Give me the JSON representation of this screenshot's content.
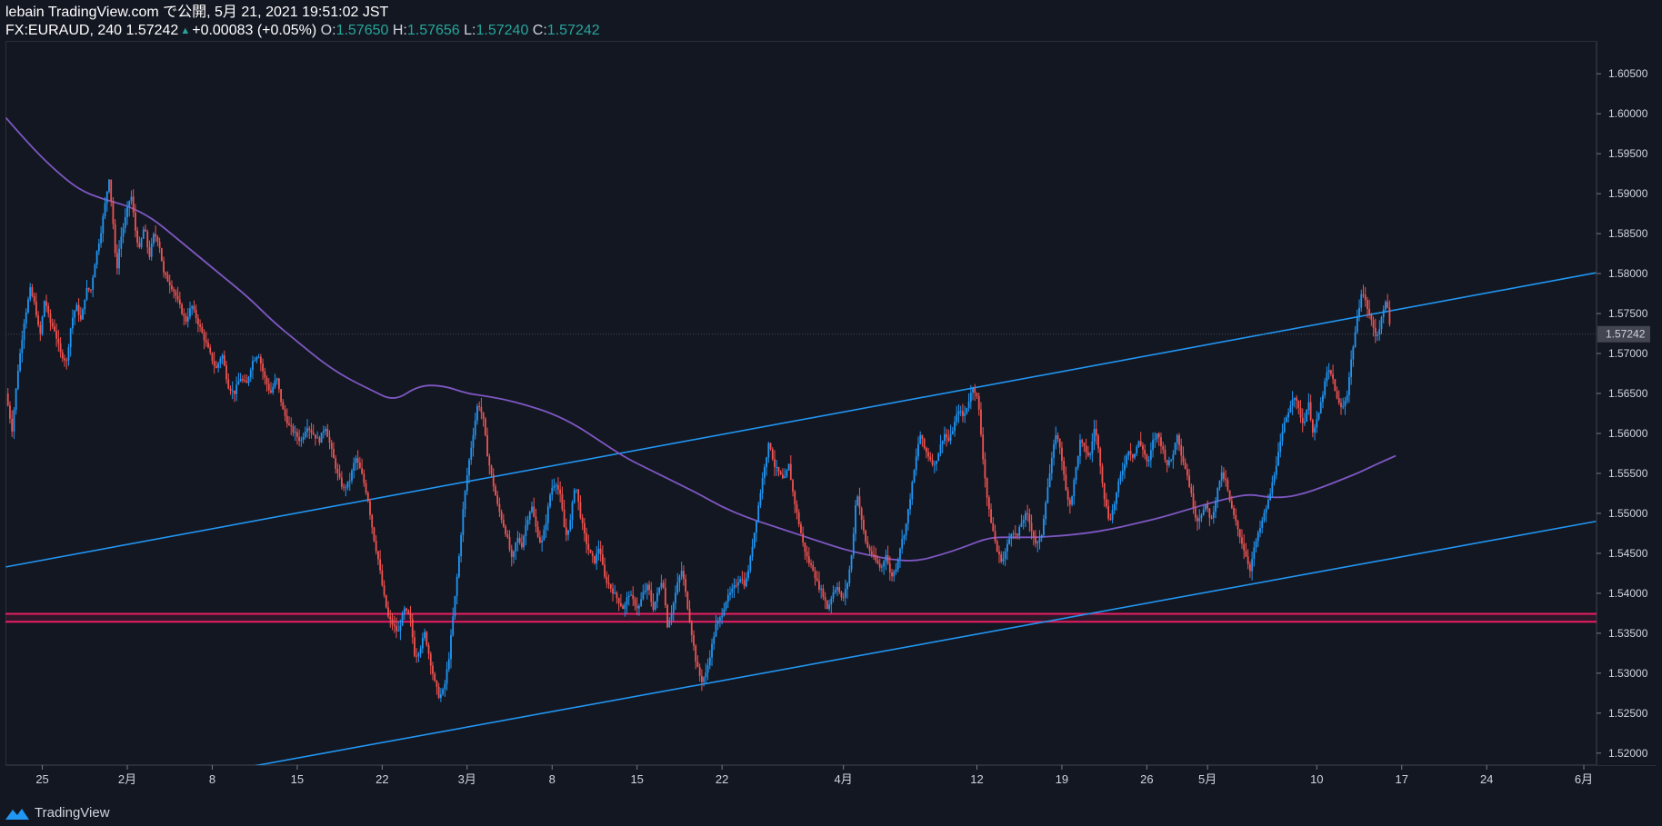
{
  "header": {
    "publish_line": "lebain TradingView.com で公開, 5月 21, 2021 19:51:02 JST",
    "symbol": "FX:EURAUD, 240 1.57242",
    "change": "+0.00083 (+0.05%)",
    "o_label": "O:",
    "o_value": "1.57650",
    "h_label": "H:",
    "h_value": "1.57656",
    "l_label": "L:",
    "l_value": "1.57240",
    "c_label": "C:",
    "c_value": "1.57242"
  },
  "footer": {
    "brand": "TradingView"
  },
  "colors": {
    "background": "#131722",
    "up_candle": "#2196f3",
    "down_candle": "#ef5350",
    "trendline": "#2196f3",
    "moving_average": "#7e57c2",
    "support_zone": "#e91e63",
    "last_price_badge": "#434651",
    "change_green": "#26a69a"
  },
  "chart_data": {
    "type": "line",
    "symbol": "FX:EURAUD",
    "timeframe": "240",
    "x_ticks": [
      {
        "label": "25",
        "day": -7
      },
      {
        "label": "2月",
        "day": 0
      },
      {
        "label": "8",
        "day": 7
      },
      {
        "label": "15",
        "day": 14
      },
      {
        "label": "22",
        "day": 21
      },
      {
        "label": "3月",
        "day": 28
      },
      {
        "label": "8",
        "day": 35
      },
      {
        "label": "15",
        "day": 42
      },
      {
        "label": "22",
        "day": 49
      },
      {
        "label": "4月",
        "day": 59
      },
      {
        "label": "12",
        "day": 70
      },
      {
        "label": "19",
        "day": 77
      },
      {
        "label": "26",
        "day": 84
      },
      {
        "label": "5月",
        "day": 89
      },
      {
        "label": "10",
        "day": 98
      },
      {
        "label": "17",
        "day": 105
      },
      {
        "label": "24",
        "day": 112
      },
      {
        "label": "6月",
        "day": 120
      }
    ],
    "y_ticks": [
      "1.60500",
      "1.60000",
      "1.59500",
      "1.59000",
      "1.58500",
      "1.58000",
      "1.57500",
      "1.57000",
      "1.56500",
      "1.56000",
      "1.55500",
      "1.55000",
      "1.54500",
      "1.54000",
      "1.53500",
      "1.53000",
      "1.52500",
      "1.52000"
    ],
    "y_range": [
      1.5185,
      1.609
    ],
    "last_price": "1.57242",
    "price_path": [
      [
        -10,
        1.565
      ],
      [
        -9.5,
        1.5605
      ],
      [
        -9,
        1.568
      ],
      [
        -8.5,
        1.574
      ],
      [
        -8,
        1.578
      ],
      [
        -7.6,
        1.576
      ],
      [
        -7.2,
        1.572
      ],
      [
        -6.8,
        1.577
      ],
      [
        -6.4,
        1.574
      ],
      [
        -6,
        1.573
      ],
      [
        -5.5,
        1.57
      ],
      [
        -5,
        1.569
      ],
      [
        -4.6,
        1.574
      ],
      [
        -4.2,
        1.576
      ],
      [
        -3.8,
        1.574
      ],
      [
        -3.4,
        1.578
      ],
      [
        -3,
        1.578
      ],
      [
        -2.6,
        1.582
      ],
      [
        -2.2,
        1.585
      ],
      [
        -1.8,
        1.589
      ],
      [
        -1.5,
        1.592
      ],
      [
        -1.2,
        1.587
      ],
      [
        -0.9,
        1.58
      ],
      [
        -0.6,
        1.584
      ],
      [
        -0.3,
        1.586
      ],
      [
        0,
        1.588
      ],
      [
        0.3,
        1.59
      ],
      [
        0.7,
        1.585
      ],
      [
        1,
        1.583
      ],
      [
        1.4,
        1.586
      ],
      [
        1.8,
        1.582
      ],
      [
        2.2,
        1.585
      ],
      [
        2.6,
        1.584
      ],
      [
        3,
        1.58
      ],
      [
        3.4,
        1.579
      ],
      [
        3.8,
        1.578
      ],
      [
        4.3,
        1.576
      ],
      [
        4.8,
        1.574
      ],
      [
        5.3,
        1.576
      ],
      [
        5.8,
        1.574
      ],
      [
        6.3,
        1.572
      ],
      [
        6.8,
        1.57
      ],
      [
        7.3,
        1.568
      ],
      [
        7.8,
        1.57
      ],
      [
        8.3,
        1.566
      ],
      [
        8.8,
        1.565
      ],
      [
        9.3,
        1.567
      ],
      [
        9.8,
        1.566
      ],
      [
        10.3,
        1.569
      ],
      [
        10.8,
        1.57
      ],
      [
        11.3,
        1.567
      ],
      [
        11.8,
        1.565
      ],
      [
        12.3,
        1.567
      ],
      [
        12.8,
        1.563
      ],
      [
        13.3,
        1.561
      ],
      [
        13.8,
        1.56
      ],
      [
        14.3,
        1.559
      ],
      [
        14.8,
        1.561
      ],
      [
        15.3,
        1.56
      ],
      [
        15.8,
        1.559
      ],
      [
        16.3,
        1.561
      ],
      [
        16.8,
        1.558
      ],
      [
        17.3,
        1.555
      ],
      [
        17.8,
        1.553
      ],
      [
        18.3,
        1.554
      ],
      [
        18.8,
        1.557
      ],
      [
        19.3,
        1.555
      ],
      [
        19.8,
        1.552
      ],
      [
        20.3,
        1.547
      ],
      [
        20.7,
        1.544
      ],
      [
        21.1,
        1.54
      ],
      [
        21.5,
        1.537
      ],
      [
        21.9,
        1.536
      ],
      [
        22.3,
        1.535
      ],
      [
        22.8,
        1.538
      ],
      [
        23.3,
        1.537
      ],
      [
        23.7,
        1.532
      ],
      [
        24.1,
        1.533
      ],
      [
        24.5,
        1.535
      ],
      [
        24.9,
        1.532
      ],
      [
        25.3,
        1.529
      ],
      [
        25.7,
        1.527
      ],
      [
        26.1,
        1.528
      ],
      [
        26.5,
        1.532
      ],
      [
        26.9,
        1.538
      ],
      [
        27.3,
        1.544
      ],
      [
        27.7,
        1.551
      ],
      [
        28.1,
        1.556
      ],
      [
        28.5,
        1.56
      ],
      [
        28.9,
        1.564
      ],
      [
        29.3,
        1.562
      ],
      [
        29.7,
        1.557
      ],
      [
        30.1,
        1.554
      ],
      [
        30.5,
        1.551
      ],
      [
        30.9,
        1.549
      ],
      [
        31.3,
        1.547
      ],
      [
        31.7,
        1.544
      ],
      [
        32.1,
        1.547
      ],
      [
        32.5,
        1.546
      ],
      [
        32.9,
        1.549
      ],
      [
        33.3,
        1.551
      ],
      [
        33.7,
        1.548
      ],
      [
        34.1,
        1.546
      ],
      [
        34.5,
        1.549
      ],
      [
        34.9,
        1.553
      ],
      [
        35.3,
        1.554
      ],
      [
        35.7,
        1.552
      ],
      [
        36.1,
        1.547
      ],
      [
        36.5,
        1.549
      ],
      [
        36.9,
        1.554
      ],
      [
        37.3,
        1.55
      ],
      [
        37.7,
        1.547
      ],
      [
        38.1,
        1.545
      ],
      [
        38.5,
        1.544
      ],
      [
        38.9,
        1.546
      ],
      [
        39.3,
        1.542
      ],
      [
        39.7,
        1.541
      ],
      [
        40.1,
        1.54
      ],
      [
        40.5,
        1.539
      ],
      [
        40.9,
        1.538
      ],
      [
        41.3,
        1.54
      ],
      [
        41.7,
        1.539
      ],
      [
        42.1,
        1.538
      ],
      [
        42.5,
        1.54
      ],
      [
        42.9,
        1.541
      ],
      [
        43.3,
        1.538
      ],
      [
        43.7,
        1.54
      ],
      [
        44.1,
        1.542
      ],
      [
        44.5,
        1.536
      ],
      [
        44.9,
        1.538
      ],
      [
        45.3,
        1.541
      ],
      [
        45.7,
        1.543
      ],
      [
        46.1,
        1.539
      ],
      [
        46.5,
        1.535
      ],
      [
        46.9,
        1.531
      ],
      [
        47.3,
        1.529
      ],
      [
        47.7,
        1.53
      ],
      [
        48.1,
        1.533
      ],
      [
        48.5,
        1.536
      ],
      [
        48.9,
        1.537
      ],
      [
        49.3,
        1.539
      ],
      [
        49.7,
        1.54
      ],
      [
        50.1,
        1.541
      ],
      [
        50.5,
        1.542
      ],
      [
        50.9,
        1.541
      ],
      [
        51.3,
        1.544
      ],
      [
        51.7,
        1.548
      ],
      [
        52.1,
        1.552
      ],
      [
        52.5,
        1.556
      ],
      [
        52.9,
        1.559
      ],
      [
        53.3,
        1.556
      ],
      [
        53.7,
        1.555
      ],
      [
        54.1,
        1.554
      ],
      [
        54.5,
        1.556
      ],
      [
        54.9,
        1.552
      ],
      [
        55.3,
        1.549
      ],
      [
        55.7,
        1.546
      ],
      [
        56.1,
        1.544
      ],
      [
        56.5,
        1.543
      ],
      [
        56.9,
        1.541
      ],
      [
        57.3,
        1.54
      ],
      [
        57.7,
        1.538
      ],
      [
        58.1,
        1.54
      ],
      [
        58.5,
        1.541
      ],
      [
        58.9,
        1.539
      ],
      [
        59.3,
        1.541
      ],
      [
        59.7,
        1.545
      ],
      [
        60.1,
        1.553
      ],
      [
        60.5,
        1.549
      ],
      [
        60.9,
        1.546
      ],
      [
        61.3,
        1.545
      ],
      [
        61.7,
        1.544
      ],
      [
        62.1,
        1.543
      ],
      [
        62.5,
        1.545
      ],
      [
        62.9,
        1.542
      ],
      [
        63.3,
        1.543
      ],
      [
        63.7,
        1.546
      ],
      [
        64.1,
        1.548
      ],
      [
        64.5,
        1.552
      ],
      [
        64.9,
        1.556
      ],
      [
        65.3,
        1.56
      ],
      [
        65.7,
        1.558
      ],
      [
        66.1,
        1.557
      ],
      [
        66.5,
        1.556
      ],
      [
        66.9,
        1.558
      ],
      [
        67.3,
        1.56
      ],
      [
        67.7,
        1.559
      ],
      [
        68.1,
        1.561
      ],
      [
        68.5,
        1.563
      ],
      [
        68.9,
        1.562
      ],
      [
        69.3,
        1.564
      ],
      [
        69.7,
        1.566
      ],
      [
        70.1,
        1.564
      ],
      [
        70.5,
        1.557
      ],
      [
        70.9,
        1.551
      ],
      [
        71.3,
        1.548
      ],
      [
        71.7,
        1.545
      ],
      [
        72.1,
        1.544
      ],
      [
        72.5,
        1.546
      ],
      [
        72.9,
        1.548
      ],
      [
        73.3,
        1.547
      ],
      [
        73.7,
        1.549
      ],
      [
        74.1,
        1.55
      ],
      [
        74.5,
        1.548
      ],
      [
        74.9,
        1.546
      ],
      [
        75.3,
        1.547
      ],
      [
        75.7,
        1.552
      ],
      [
        76.1,
        1.556
      ],
      [
        76.5,
        1.56
      ],
      [
        76.9,
        1.558
      ],
      [
        77.3,
        1.553
      ],
      [
        77.7,
        1.551
      ],
      [
        78.1,
        1.555
      ],
      [
        78.5,
        1.559
      ],
      [
        78.9,
        1.558
      ],
      [
        79.3,
        1.557
      ],
      [
        79.7,
        1.561
      ],
      [
        80.1,
        1.557
      ],
      [
        80.5,
        1.552
      ],
      [
        80.9,
        1.549
      ],
      [
        81.3,
        1.551
      ],
      [
        81.7,
        1.554
      ],
      [
        82.1,
        1.556
      ],
      [
        82.5,
        1.558
      ],
      [
        82.9,
        1.557
      ],
      [
        83.3,
        1.559
      ],
      [
        83.7,
        1.558
      ],
      [
        84.1,
        1.556
      ],
      [
        84.5,
        1.559
      ],
      [
        84.9,
        1.56
      ],
      [
        85.3,
        1.558
      ],
      [
        85.7,
        1.556
      ],
      [
        86.1,
        1.557
      ],
      [
        86.5,
        1.56
      ],
      [
        86.9,
        1.557
      ],
      [
        87.3,
        1.555
      ],
      [
        87.7,
        1.552
      ],
      [
        88.1,
        1.549
      ],
      [
        88.5,
        1.55
      ],
      [
        88.9,
        1.551
      ],
      [
        89.3,
        1.549
      ],
      [
        89.7,
        1.552
      ],
      [
        90.1,
        1.555
      ],
      [
        90.5,
        1.554
      ],
      [
        90.9,
        1.551
      ],
      [
        91.3,
        1.549
      ],
      [
        91.7,
        1.547
      ],
      [
        92.1,
        1.545
      ],
      [
        92.5,
        1.543
      ],
      [
        92.9,
        1.546
      ],
      [
        93.3,
        1.548
      ],
      [
        93.7,
        1.55
      ],
      [
        94.1,
        1.552
      ],
      [
        94.5,
        1.555
      ],
      [
        94.9,
        1.558
      ],
      [
        95.3,
        1.561
      ],
      [
        95.7,
        1.563
      ],
      [
        96.1,
        1.565
      ],
      [
        96.5,
        1.563
      ],
      [
        96.9,
        1.561
      ],
      [
        97.3,
        1.564
      ],
      [
        97.7,
        1.56
      ],
      [
        98.1,
        1.562
      ],
      [
        98.5,
        1.565
      ],
      [
        98.9,
        1.568
      ],
      [
        99.3,
        1.567
      ],
      [
        99.7,
        1.564
      ],
      [
        100.1,
        1.563
      ],
      [
        100.5,
        1.565
      ],
      [
        100.9,
        1.57
      ],
      [
        101.3,
        1.574
      ],
      [
        101.7,
        1.578
      ],
      [
        102.1,
        1.576
      ],
      [
        102.5,
        1.574
      ],
      [
        102.9,
        1.572
      ],
      [
        103.3,
        1.574
      ],
      [
        103.7,
        1.577
      ],
      [
        104.1,
        1.5724
      ]
    ],
    "moving_average": [
      [
        -10,
        1.5995
      ],
      [
        -8,
        1.596
      ],
      [
        -6,
        1.593
      ],
      [
        -4,
        1.5905
      ],
      [
        -2,
        1.5893
      ],
      [
        0,
        1.5885
      ],
      [
        2,
        1.587
      ],
      [
        4,
        1.5845
      ],
      [
        6,
        1.582
      ],
      [
        8,
        1.5795
      ],
      [
        10,
        1.577
      ],
      [
        12,
        1.574
      ],
      [
        14,
        1.5715
      ],
      [
        16,
        1.569
      ],
      [
        18,
        1.567
      ],
      [
        20,
        1.5655
      ],
      [
        22,
        1.564
      ],
      [
        24,
        1.566
      ],
      [
        26,
        1.566
      ],
      [
        28,
        1.565
      ],
      [
        29,
        1.5648
      ],
      [
        31,
        1.5643
      ],
      [
        33,
        1.5635
      ],
      [
        35,
        1.5625
      ],
      [
        37,
        1.561
      ],
      [
        39,
        1.559
      ],
      [
        41,
        1.557
      ],
      [
        43,
        1.5555
      ],
      [
        45,
        1.554
      ],
      [
        47,
        1.5525
      ],
      [
        49,
        1.5508
      ],
      [
        51,
        1.5495
      ],
      [
        53,
        1.5485
      ],
      [
        55,
        1.5475
      ],
      [
        57,
        1.5465
      ],
      [
        59,
        1.5455
      ],
      [
        61,
        1.5448
      ],
      [
        63,
        1.5442
      ],
      [
        65,
        1.544
      ],
      [
        67,
        1.5448
      ],
      [
        69,
        1.5458
      ],
      [
        71,
        1.547
      ],
      [
        73,
        1.547
      ],
      [
        75,
        1.547
      ],
      [
        77,
        1.5472
      ],
      [
        79,
        1.5475
      ],
      [
        81,
        1.548
      ],
      [
        83,
        1.5487
      ],
      [
        85,
        1.5494
      ],
      [
        87,
        1.5503
      ],
      [
        89,
        1.5512
      ],
      [
        91,
        1.552
      ],
      [
        92.5,
        1.5524
      ],
      [
        94,
        1.552
      ],
      [
        95.5,
        1.552
      ],
      [
        97,
        1.5525
      ],
      [
        98.5,
        1.5533
      ],
      [
        100,
        1.5542
      ],
      [
        101.5,
        1.5551
      ],
      [
        103,
        1.5562
      ],
      [
        104.5,
        1.5572
      ]
    ],
    "trendlines": [
      {
        "name": "upper-channel",
        "from": [
          -10,
          1.5433
        ],
        "to": [
          121,
          1.5801
        ]
      },
      {
        "name": "lower-channel",
        "from": [
          9,
          1.518
        ],
        "to": [
          121,
          1.549
        ]
      }
    ],
    "horizontal_levels": [
      1.53743,
      1.53643
    ],
    "grid": false
  }
}
